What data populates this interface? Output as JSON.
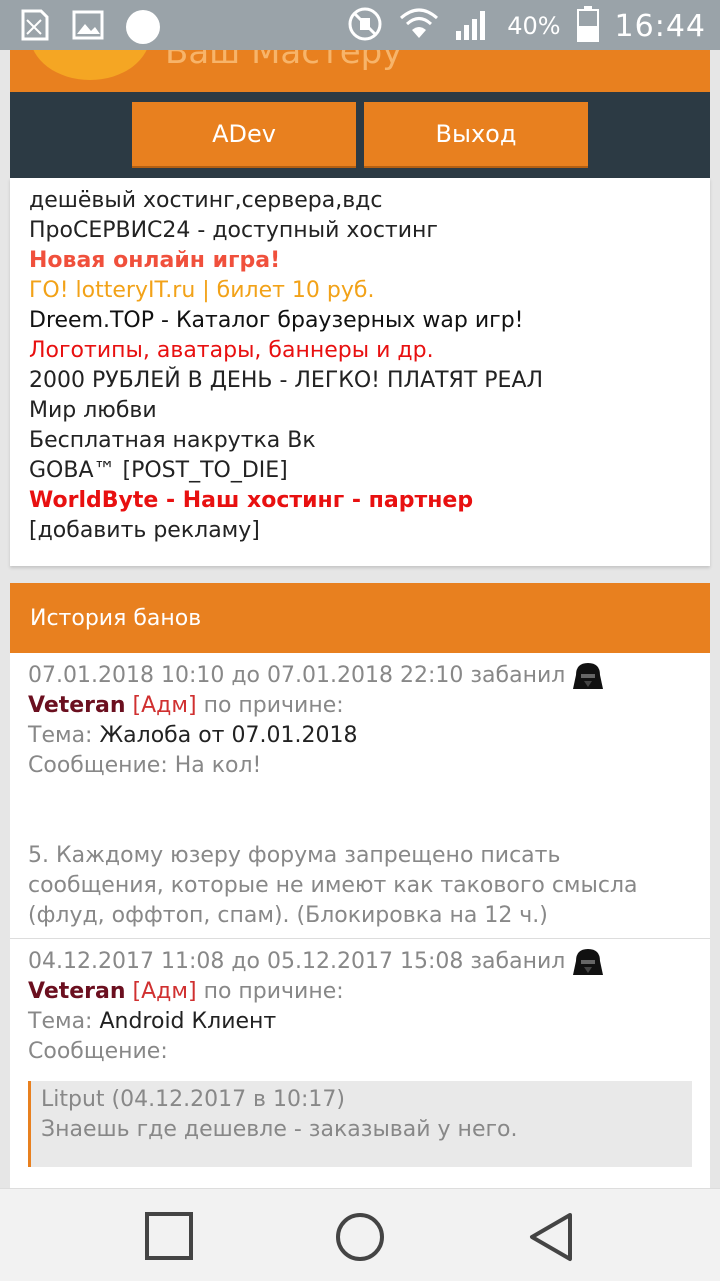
{
  "status_bar": {
    "battery_percent": "40%",
    "time": "16:44",
    "icons": [
      "sim-icon",
      "image-icon",
      "record-dot-icon",
      "mute-icon",
      "wifi-icon",
      "signal-icon",
      "battery-icon"
    ]
  },
  "header": {
    "partial_title": "Ваш Мастеру",
    "buttons": {
      "adev": "ADev",
      "exit": "Выход"
    },
    "colors": {
      "accent": "#e8801f",
      "nav_bg": "#2c3a44"
    }
  },
  "ads": [
    {
      "text": "дешёвый хостинг,сервера,вдс",
      "color": "#222222",
      "bold": false
    },
    {
      "text": "ПроСЕРВИС24 - доступный хостинг",
      "color": "#222222",
      "bold": false
    },
    {
      "text": "Новая онлайн игра!",
      "color": "#f0503c",
      "bold": true
    },
    {
      "text": "ГО! lotteryIT.ru | билет 10 руб.",
      "color": "#f2a218",
      "bold": false
    },
    {
      "text": "Dreem.TOP - Каталог браузерных wap игр!",
      "color": "#111111",
      "bold": false
    },
    {
      "text": "Логотипы, аватары, баннеры и др.",
      "color": "#e81010",
      "bold": false
    },
    {
      "text": "2000 РУБЛЕЙ В ДЕНЬ - ЛЕГКО! ПЛАТЯТ РЕАЛ",
      "color": "#222222",
      "bold": false
    },
    {
      "text": "Мир любви",
      "color": "#222222",
      "bold": false
    },
    {
      "text": "Бесплатная накрутка Вк",
      "color": "#222222",
      "bold": false
    },
    {
      "text": "GOBA™ [POST_TO_DIE]",
      "color": "#222222",
      "bold": false
    },
    {
      "text": "WorldByte - Наш хостинг - партнер",
      "color": "#e81010",
      "bold": true
    },
    {
      "text": "[добавить рекламу]",
      "color": "#222222",
      "bold": false
    }
  ],
  "bans": {
    "title": "История банов",
    "entries": [
      {
        "period": "07.01.2018 10:10 до 07.01.2018 22:10 забанил",
        "admin_name": "Veteran",
        "admin_tag": "[Адм]",
        "reason_label": "по причине:",
        "topic_label": "Тема:",
        "topic": "Жалоба от 07.01.2018",
        "message_label": "Сообщение:",
        "message": "На кол!",
        "rule": "5. Каждому юзеру форума запрещено писать сообщения, которые не имеют как такового смысла (флуд, оффтоп, спам). (Блокировка на 12 ч.)"
      },
      {
        "period": "04.12.2017 11:08 до 05.12.2017 15:08 забанил",
        "admin_name": "Veteran",
        "admin_tag": "[Адм]",
        "reason_label": "по причине:",
        "topic_label": "Тема:",
        "topic": "Android Клиент",
        "message_label": "Сообщение:",
        "quote_author": "Litput (04.12.2017 в 10:17)",
        "quote_text": "Знаешь где дешевле - заказывай у него."
      }
    ]
  },
  "navbar": {
    "icons": [
      "recents-icon",
      "home-icon",
      "back-icon"
    ]
  }
}
